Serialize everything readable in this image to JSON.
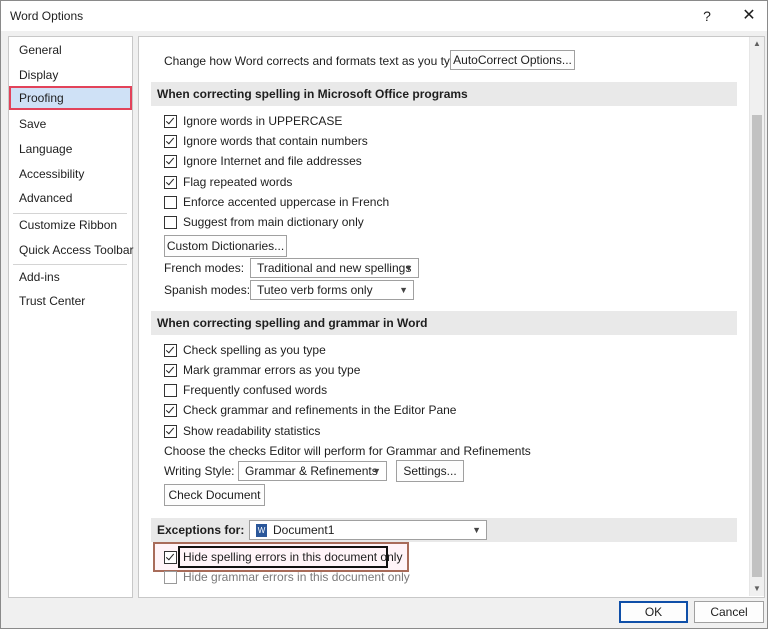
{
  "window": {
    "title": "Word Options",
    "help": "?",
    "close": "✕"
  },
  "nav": {
    "items": [
      {
        "label": "General"
      },
      {
        "label": "Display"
      },
      {
        "label": "Proofing",
        "selected": true
      },
      {
        "label": "Save"
      },
      {
        "label": "Language"
      },
      {
        "label": "Accessibility"
      },
      {
        "label": "Advanced"
      },
      {
        "label": "Customize Ribbon"
      },
      {
        "label": "Quick Access Toolbar"
      },
      {
        "label": "Add-ins"
      },
      {
        "label": "Trust Center"
      }
    ]
  },
  "autocorrect": {
    "label": "Change how Word corrects and formats text as you type:",
    "button": "AutoCorrect Options..."
  },
  "office_section": {
    "header": "When correcting spelling in Microsoft Office programs",
    "options": [
      {
        "label": "Ignore words in UPPERCASE",
        "checked": true
      },
      {
        "label": "Ignore words that contain numbers",
        "checked": true
      },
      {
        "label": "Ignore Internet and file addresses",
        "checked": true
      },
      {
        "label": "Flag repeated words",
        "checked": true
      },
      {
        "label": "Enforce accented uppercase in French",
        "checked": false
      },
      {
        "label": "Suggest from main dictionary only",
        "checked": false
      }
    ],
    "custom_dictionaries": "Custom Dictionaries...",
    "french_label": "French modes:",
    "french_value": "Traditional and new spellings",
    "spanish_label": "Spanish modes:",
    "spanish_value": "Tuteo verb forms only"
  },
  "word_section": {
    "header": "When correcting spelling and grammar in Word",
    "options": [
      {
        "label": "Check spelling as you type",
        "checked": true
      },
      {
        "label": "Mark grammar errors as you type",
        "checked": true
      },
      {
        "label": "Frequently confused words",
        "checked": false
      },
      {
        "label": "Check grammar and refinements in the Editor Pane",
        "checked": true
      },
      {
        "label": "Show readability statistics",
        "checked": true
      }
    ],
    "editor_text": "Choose the checks Editor will perform for Grammar and Refinements",
    "writing_style_label": "Writing Style:",
    "writing_style_value": "Grammar & Refinements",
    "settings": "Settings...",
    "check_document": "Check Document"
  },
  "exceptions": {
    "label": "Exceptions for:",
    "document": "Document1",
    "doc_icon": "W",
    "options": [
      {
        "label": "Hide spelling errors in this document only",
        "checked": true
      },
      {
        "label": "Hide grammar errors in this document only",
        "checked": false
      }
    ]
  },
  "footer": {
    "ok": "OK",
    "cancel": "Cancel"
  },
  "colors": {
    "accent": "#0f4fa8",
    "selection": "#cfe1f6",
    "highlight_red": "#e2435a",
    "highlight_brown": "#a86c5a"
  }
}
